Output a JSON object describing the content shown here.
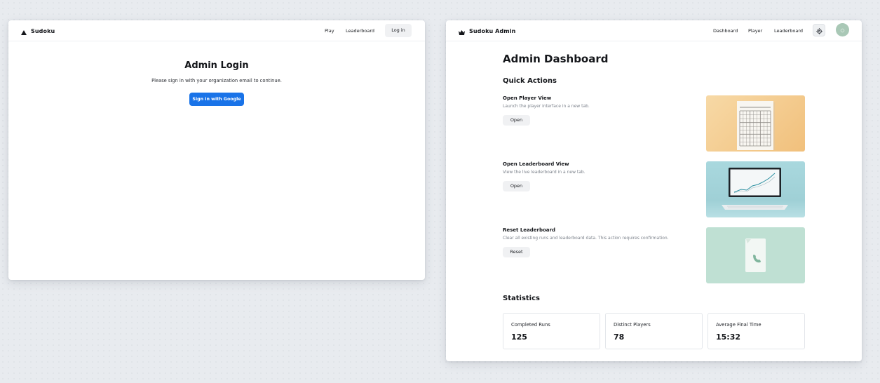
{
  "login_window": {
    "brand": "Sudoku",
    "brand_icon": "triangle-logo-icon",
    "nav": {
      "play": "Play",
      "leaderboard": "Leaderboard",
      "login": "Log in"
    },
    "title": "Admin Login",
    "message": "Please sign in with your organization email to continue.",
    "google_button": "Sign in with Google",
    "accent_color": "#1973e8"
  },
  "admin_window": {
    "brand": "Sudoku Admin",
    "brand_icon": "crown-logo-icon",
    "nav": {
      "dashboard": "Dashboard",
      "player": "Player",
      "leaderboard": "Leaderboard"
    },
    "settings_icon": "gear-icon",
    "avatar_icon": "user-avatar-icon",
    "title": "Admin Dashboard",
    "quick_actions_title": "Quick Actions",
    "actions": [
      {
        "title": "Open Player View",
        "description": "Launch the player interface in a new tab.",
        "button": "Open",
        "image": "sudoku-puzzle-image"
      },
      {
        "title": "Open Leaderboard View",
        "description": "View the live leaderboard in a new tab.",
        "button": "Open",
        "image": "laptop-chart-image"
      },
      {
        "title": "Reset Leaderboard",
        "description": "Clear all existing runs and leaderboard data. This action requires confirmation.",
        "button": "Reset",
        "image": "phone-card-image"
      }
    ],
    "statistics_title": "Statistics",
    "stats": [
      {
        "label": "Completed Runs",
        "value": "125"
      },
      {
        "label": "Distinct Players",
        "value": "78"
      },
      {
        "label": "Average Final Time",
        "value": "15:32"
      }
    ]
  }
}
